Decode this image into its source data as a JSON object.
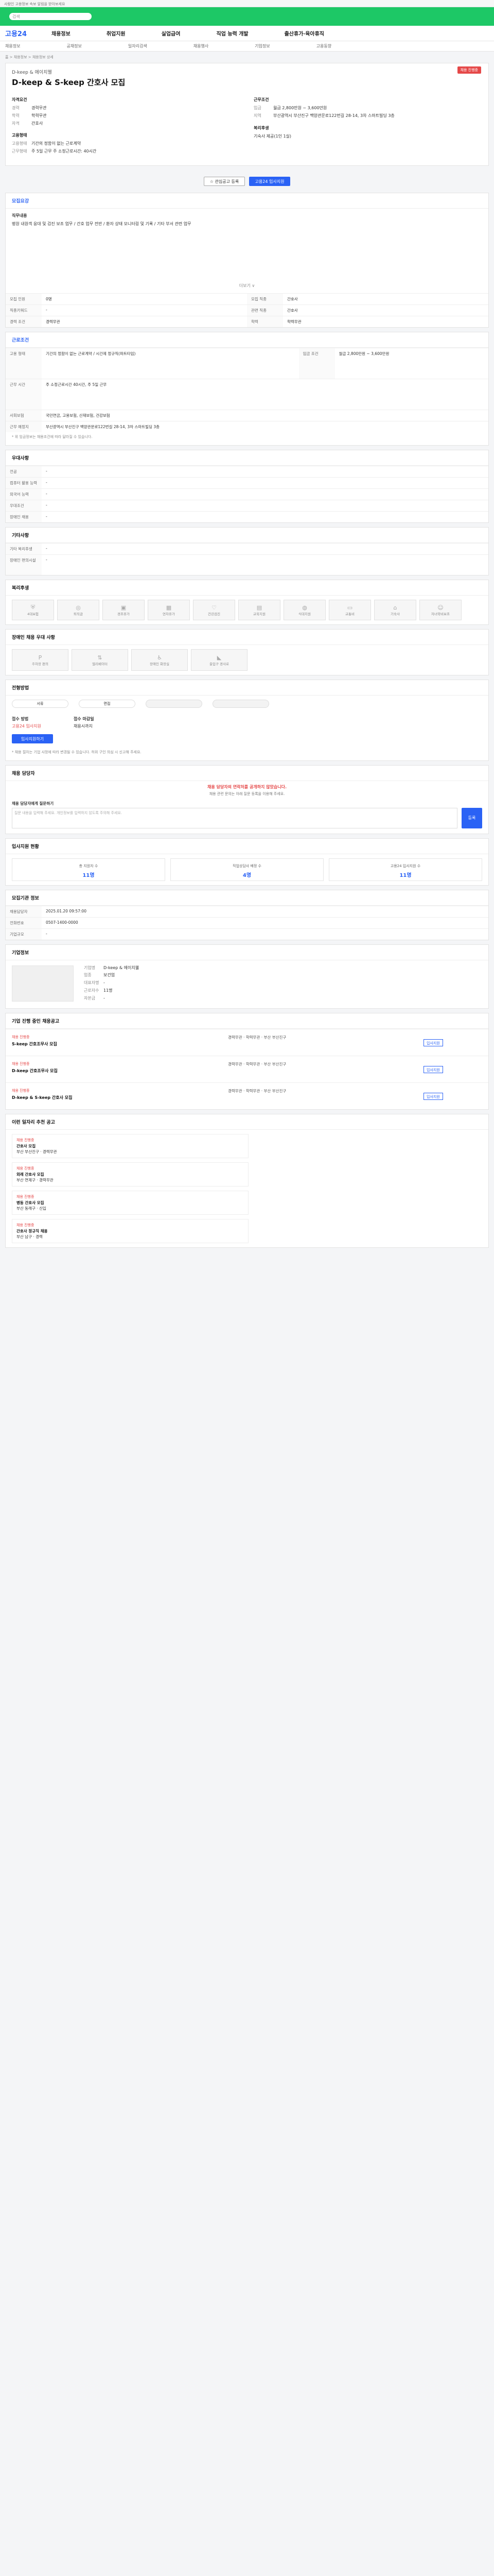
{
  "topbar": {
    "notice": "사람인 고용정보 속보 알림을 받아보세요"
  },
  "hero": {
    "search_placeholder": "검색"
  },
  "gnb": {
    "logo": "고용24",
    "menu": [
      "채용정보",
      "취업지원",
      "실업급여",
      "직업 능력 개발",
      "출산휴가·육아휴직"
    ]
  },
  "subnav": [
    "채용정보",
    "공채정보",
    "일자리검색",
    "채용행사",
    "기업정보",
    "고용동향"
  ],
  "breadcrumb": "홈 > 채용정보 > 채용정보 상세",
  "job": {
    "company": "D-keep & 에이치웰",
    "title": "D-keep & S-keep 간호사 모집",
    "status": "채용 진행중",
    "qual_title": "자격요건",
    "qual_rows": [
      {
        "k": "경력",
        "v": "경력무관"
      },
      {
        "k": "학력",
        "v": "학력무관"
      },
      {
        "k": "자격",
        "v": "간호사"
      }
    ],
    "terms_title": "근무조건",
    "terms_rows": [
      {
        "k": "임금",
        "v": "월급 2,800만원 ~ 3,600만원"
      },
      {
        "k": "지역",
        "v": "부산광역시 부산진구 백양관문로122번길 28-14, 3차 스마트빌딩 3층"
      }
    ],
    "type_title": "고용형태",
    "type_rows": [
      {
        "k": "고용형태",
        "v": "기간의 정함이 없는 근로계약"
      },
      {
        "k": "근무형태",
        "v": "주 5일 근무 주 소정근로시간: 40시간"
      }
    ],
    "welfare_title": "복리후생",
    "welfare_rows": [
      {
        "k": "",
        "v": "기숙사 제공(1인 1실)"
      }
    ],
    "scrap_label": "관심공고 등록",
    "apply_label": "고용24 입사지원"
  },
  "sections": {
    "detail": "모집요강",
    "duty_title": "직무내용",
    "duty_text": "병원 내원객 응대 및 검진 보조 업무 / 간호 업무 전반 / 환자 상태 모니터링 및 기록 / 기타 부서 관련 업무",
    "more": "더보기 ∨",
    "table": [
      {
        "k": "모집 인원",
        "v": "0명"
      },
      {
        "k": "모집 직종",
        "v": "간호사"
      },
      {
        "k": "직종키워드",
        "v": "-"
      },
      {
        "k": "관련 직종",
        "v": "간호사"
      },
      {
        "k": "경력 조건",
        "v": "경력무관"
      },
      {
        "k": "학력",
        "v": "학력무관"
      }
    ],
    "conditions": "근로조건",
    "cond_table": [
      {
        "k": "고용 형태",
        "v": "기간의 정함이 없는 근로계약 / 시간제 정규직(파트타임)"
      },
      {
        "k": "임금 조건",
        "v": "월급 2,800만원 ~ 3,600만원"
      },
      {
        "k": "근무 시간",
        "v": "주 소정근로시간 40시간, 주 5일 근무"
      },
      {
        "k": "사회보험",
        "v": "국민연금, 고용보험, 산재보험, 건강보험"
      },
      {
        "k": "근무 예정지",
        "v": "부산광역시 부산진구 백양관문로122번길 28-14, 3차 스마트빌딩 3층"
      }
    ],
    "cond_note": "* 위 임금정보는 채용조건에 따라 달라질 수 있습니다.",
    "prefer": "우대사항",
    "prefer_table": [
      {
        "k": "전공",
        "v": "-"
      },
      {
        "k": "컴퓨터 활용 능력",
        "v": "-"
      },
      {
        "k": "외국어 능력",
        "v": "-"
      },
      {
        "k": "우대조건",
        "v": "-"
      },
      {
        "k": "장애인 채용",
        "v": "-"
      }
    ],
    "etc": "기타사항",
    "etc_table": [
      {
        "k": "기타 복리후생",
        "v": "-"
      },
      {
        "k": "장애인 편의시설",
        "v": "-"
      }
    ],
    "welfare": "복리후생",
    "welfare_items": [
      "4대보험",
      "퇴직금",
      "경조휴가",
      "연차휴가",
      "건강검진",
      "교육지원",
      "식대지원",
      "교통비",
      "기숙사",
      "자녀학비보조"
    ],
    "disabled": "장애인 채용 우대 사항",
    "disabled_items": [
      "주차장 편의",
      "엘리베이터",
      "장애인 화장실",
      "출입구 경사로"
    ],
    "process": "전형방법",
    "process_steps": [
      "서류",
      "면접",
      "",
      ""
    ],
    "apply_title": "접수 방법",
    "apply_method": "고용24 입사지원",
    "deadline_title": "접수 마감일",
    "deadline_value": "채용시까지",
    "apply_button": "입사지원하기",
    "process_note": "* 채용 절차는 기업 사정에 따라 변경될 수 있습니다. 허위 구인 의심 시 신고해 주세요.",
    "contact": "채용 담당자",
    "contact_warn": "채용 담당자의 연락처를 공개하지 않았습니다.",
    "contact_sub": "채용 관련 문의는 아래 질문 등록을 이용해 주세요.",
    "ask_title": "채용 담당자에게 질문하기",
    "ask_placeholder": "질문 내용을 입력해 주세요. 개인정보를 입력하지 않도록 주의해 주세요.",
    "ask_button": "등록",
    "stats": "입사지원 현황",
    "stat_items": [
      {
        "label": "총 지원자 수",
        "value": "11명"
      },
      {
        "label": "직업상담사 배정 수",
        "value": "4명"
      },
      {
        "label": "고용24 입사지원 수",
        "value": "11명"
      }
    ],
    "info": "모집기관 정보",
    "info_table": [
      {
        "k": "채용담당자",
        "v": "2025.01.20 09:57:00"
      },
      {
        "k": "전화번호",
        "v": "0507-1400-0000"
      },
      {
        "k": "기업규모",
        "v": "-"
      }
    ],
    "company_info": "기업정보",
    "company_rows": [
      {
        "k": "기업명",
        "v": "D-keep & 에이치웰"
      },
      {
        "k": "업종",
        "v": "보건업"
      },
      {
        "k": "대표자명",
        "v": "-"
      },
      {
        "k": "근로자수",
        "v": "11명"
      },
      {
        "k": "자본금",
        "v": "-"
      }
    ],
    "other": "기업 진행 중인 채용공고",
    "other_jobs": [
      {
        "tag": "채용 진행중",
        "title": "S-keep 간호조무사 모집",
        "meta": "경력무관 · 학력무관 · 부산 부산진구",
        "btn": "입사지원"
      },
      {
        "tag": "채용 진행중",
        "title": "D-keep 간호조무사 모집",
        "meta": "경력무관 · 학력무관 · 부산 부산진구",
        "btn": "입사지원"
      },
      {
        "tag": "채용 진행중",
        "title": "D-keep & S-keep 간호사 모집",
        "meta": "경력무관 · 학력무관 · 부산 부산진구",
        "btn": "입사지원"
      }
    ],
    "similar": "이런 일자리 추천 공고",
    "similar_jobs": [
      {
        "tag": "채용 진행중",
        "title": "간호사 모집",
        "meta": "부산 부산진구 · 경력무관"
      },
      {
        "tag": "채용 진행중",
        "title": "외래 간호사 모집",
        "meta": "부산 연제구 · 경력무관"
      },
      {
        "tag": "채용 진행중",
        "title": "병동 간호사 모집",
        "meta": "부산 동래구 · 신입"
      },
      {
        "tag": "채용 진행중",
        "title": "간호사 정규직 채용",
        "meta": "부산 남구 · 경력"
      }
    ]
  }
}
